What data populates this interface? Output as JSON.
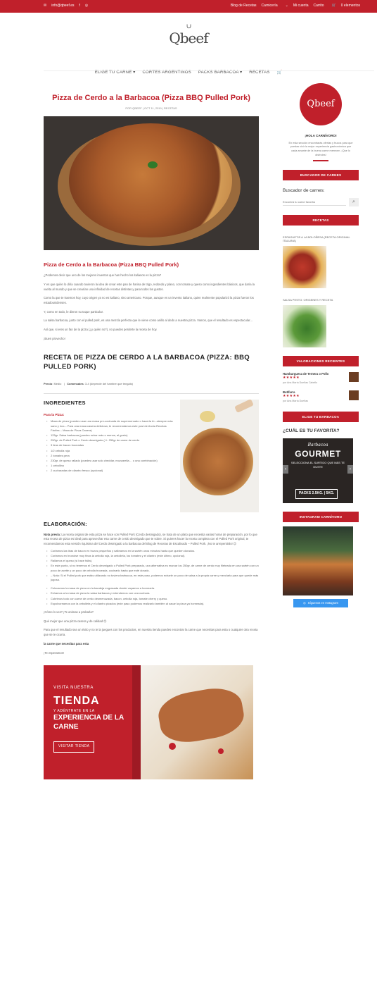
{
  "topbar": {
    "email": "info@qbeef.es",
    "social": [
      "f",
      "◎"
    ],
    "links": [
      "Blog de Recetas",
      "Carnicería",
      "Mi cuenta",
      "Carrito"
    ],
    "cart": "0 elementos"
  },
  "brand": {
    "logo_text": "Qbeef",
    "horns": "∪"
  },
  "nav": {
    "items": [
      "ELIGE TU CARNE",
      "CORTES ARGENTINOS",
      "PACKS BARBACOA",
      "RECETAS"
    ],
    "cart_icon": "cart-icon"
  },
  "post": {
    "title": "Pizza de Cerdo a la Barbacoa (Pizza BBQ Pulled Pork)",
    "meta": "POR QBEEF | OCT 11, 2019 | RECETAS",
    "h2": "Pizza de Cerdo a la Barbacoa (Pizza BBQ Pulled Pork)",
    "paragraphs": [
      "¿Podemos decir que uno de los mejores inventos que han hecho los italianos es la pizza?",
      "Y es que quién lo diría cuando tuvieron la idea de crear este pan de harina de trigo, redondo y plano, con tomate y queso como ingredientes básicos, que daría la vuelta al mundo y que se crearían una infinidad de recetas distintas y para todos los gustos.",
      "Como la que te traemos hoy, cuyo origen ya no es italiano, sino americano. Porque, aunque es un invento italiano, quien realmente popularizó la pizza fueron los estadounidenses.",
      "Y, como en todo, le dieron su toque particular.",
      "La salsa barbacoa, junto con el pulled pork, es una mezcla perfecta que le viene como anillo al dedo a nuestra pizza. Vamos, que el resultado es espectacular…",
      "Así que, si eres un fan de la pizza (¿y quién no?), no puedes perderte la receta de hoy.",
      "¡Buen provecho!"
    ]
  },
  "recipe": {
    "title": "RECETA DE PIZZA DE CERDO A LA BARBACOA (PIZZA: BBQ PULLED PORK)",
    "meta_prefix": "Precio",
    "meta_price": "Medio",
    "meta_sep": "|",
    "meta_diners_label": "Comensales",
    "meta_diners": "3-4 (depende del hambre que tengáis)",
    "ingredients_title": "INGREDIENTES",
    "ingredients_sub": "Para la Pizza:",
    "ingredients": [
      "Masa de pizza (puedes usar una masa pre-cocinada de supermercado o hacerla tú –siempre más sano y rico–. Para una masa casera deliciosa, te recomendamos este post de Annia Recetas Fáciles – Masa de Pizza Casera)",
      "125gr. Salsa barbacoa (puedes echar más o menos, al gusto)",
      "250gr. de Pulled Pork o Cerdo desmigado (+/- 250gr de carne de cerdo",
      "3 tiras de bacon troceadas",
      "1/2 cebolla roja",
      "2 tomates pera",
      "230gr. de queso rallado (puedes usar solo cheddar, mozzarella… o una combinación)",
      "1 cebollino",
      "2 cucharadas de cilantro fresco (opcional)"
    ],
    "elab_title": "ELABORACIÓN:",
    "elab_note_label": "Nota previa:",
    "elab_note": "La receta original de esta pizza se hace con Pulled Pork (Cerdo desmigado), se trata de un plato que necesita varias horas de preparación, por lo que esta receta de pizza es ideal para aprovechar esa carne de cerdo desmigado que te sobre. Si quieres hacer la receta completa con el Pulled Pork original, te recomendamos esta versión riquísima del Cerdo desmigado a la barbacoa del Blog de Recetas de Escalivado – Pulled Pork. ¡No te arrepentirás! 😉",
    "steps_a": [
      "Cortamos las tiras de bacon en trozos pequeños y salteamos en la sartén unos minutos hasta que queden dorados.",
      "Cortamos en brunoise muy finas la cebolla roja, la cebolleta, los tomates y el cilantro (este último, opcional).",
      "Rallamos el queso (si hace falta).",
      "En este punto, si no tenemos el Cerdo desmigado o Pulled Pork preparado, una alternativa es marcar los 250gr. de carne de cerdo muy fileteada en una sartén con un poco de aceite y un poco de cebolla troceada, cocinarlo hasta que esté dorado.",
      "– Nota: Si el Pulled pork que estás utilizando no tuviera barbacoa, en este paso, podemos echarle un poco de salsa a la propia carne y mezclarla para que quede más jugosa."
    ],
    "steps_b": [
      "Colocamos la masa de pizza en la bandeja engrasada donde vayamos a hornearla.",
      "Echamos a la masa de pizza la salsa barbacoa y extendemos con una cuchara.",
      "Cubrimos todo con carne de cerdo desmenuzada, bacon, cebolla roja, tomate cherry y queso.",
      "Espolvoreamos con la cebolleta y el cilantro picados (este paso podemos realizarlo también al sacar la pizza ya horneada)."
    ],
    "outro": [
      "¡Cómo lo ves? ¡Te animas a probarla?",
      "Qué mejor que una pizza casera y de calidad 😉",
      "Para que el resultado sea un éxito y no te la juegues con los productos, en nuestra tienda puedes encontrar la carne que necesitas para esta o cualquier otra receta que se te ocurra.",
      "¡Te esperamos!"
    ],
    "outro_link": "la carne que necesitas para esta"
  },
  "banner": {
    "line1": "VISITA NUESTRA",
    "line2": "TIENDA",
    "line3": "Y ADÉNTRATE EN LA",
    "line4": "EXPERIENCIA DE LA CARNE",
    "button": "VISITAR TIENDA"
  },
  "sidebar": {
    "logo": "Qbeef",
    "greeting": "¡HOLA CARNÍVORO!",
    "intro": "En esta sección encontrarás ofertas y trucos para que puedas vivir la mejor experiencia gastronómica que cada amante de la buena carne merecen. ¡Que lo disfrutes!",
    "finder_btn": "BUSCADOR DE CARNES",
    "search_label": "Buscador de carnes:",
    "search_placeholder": "Encontrá tu carne favorita",
    "recipes_btn": "RECETAS",
    "recipe1": "ESPAGUETIS A LA BOLOÑESA (RECETA ORIGINAL ITALIANA)",
    "recipe2": "SALSA PESTO: ORIGENES Y RECETA",
    "reviews_btn": "VALORACIONES RECIENTES",
    "reviews": [
      {
        "title": "Hamburguesa de Ternera o Pollo",
        "stars": "★★★★★",
        "by": "por Ana María Dueñas Cabello"
      },
      {
        "title": "Butifarra",
        "stars": "★★★★★",
        "by": "por Ana María Dueñas"
      }
    ],
    "bbq_btn": "ELIGE TU BARBACOA",
    "fav_title": "¿CUÁL ES TU FAVORITA?",
    "ad": {
      "script": "Barbacoa",
      "title": "GOURMET",
      "text": "SELECCIONA EL SURTIDO QUE MÁS TE GUSTE",
      "pack": "PACKS 2.5KG. | 5KG.",
      "prev": "‹",
      "next": "›"
    },
    "insta_btn": "INSTAGRAM CARNÍVORO",
    "insta_follow": "Síguenos en Instagram",
    "insta_icon": "instagram-icon"
  }
}
